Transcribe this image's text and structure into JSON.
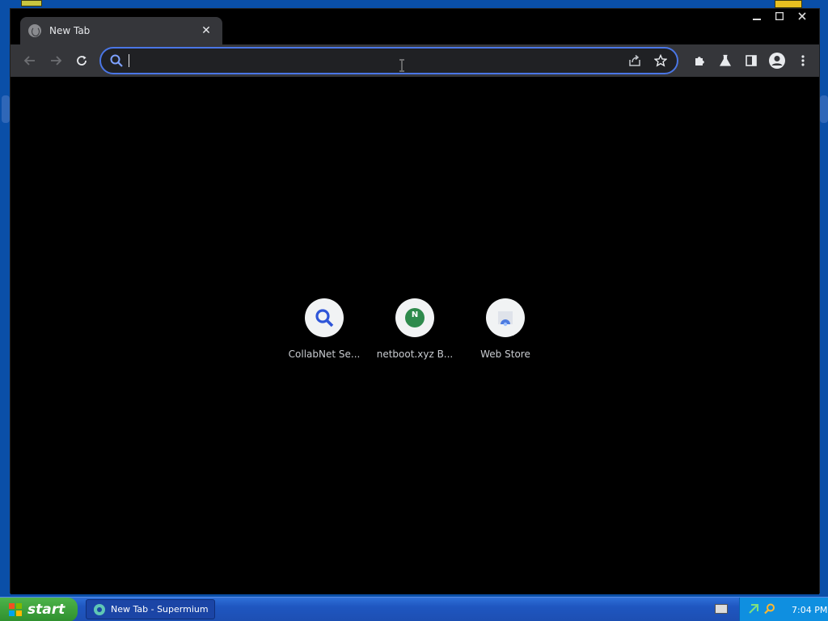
{
  "browser": {
    "tab_title": "New Tab",
    "omnibox": {
      "value": "",
      "placeholder": ""
    },
    "accent_color": "#4a76e6"
  },
  "shortcuts": [
    {
      "label": "CollabNet Se...",
      "icon": "search-icon"
    },
    {
      "label": "netboot.xyz B...",
      "icon": "netboot-icon"
    },
    {
      "label": "Web Store",
      "icon": "web-store-icon"
    }
  ],
  "taskbar": {
    "start_label": "start",
    "task_label": "New Tab - Supermium",
    "clock": "7:04 PM"
  }
}
